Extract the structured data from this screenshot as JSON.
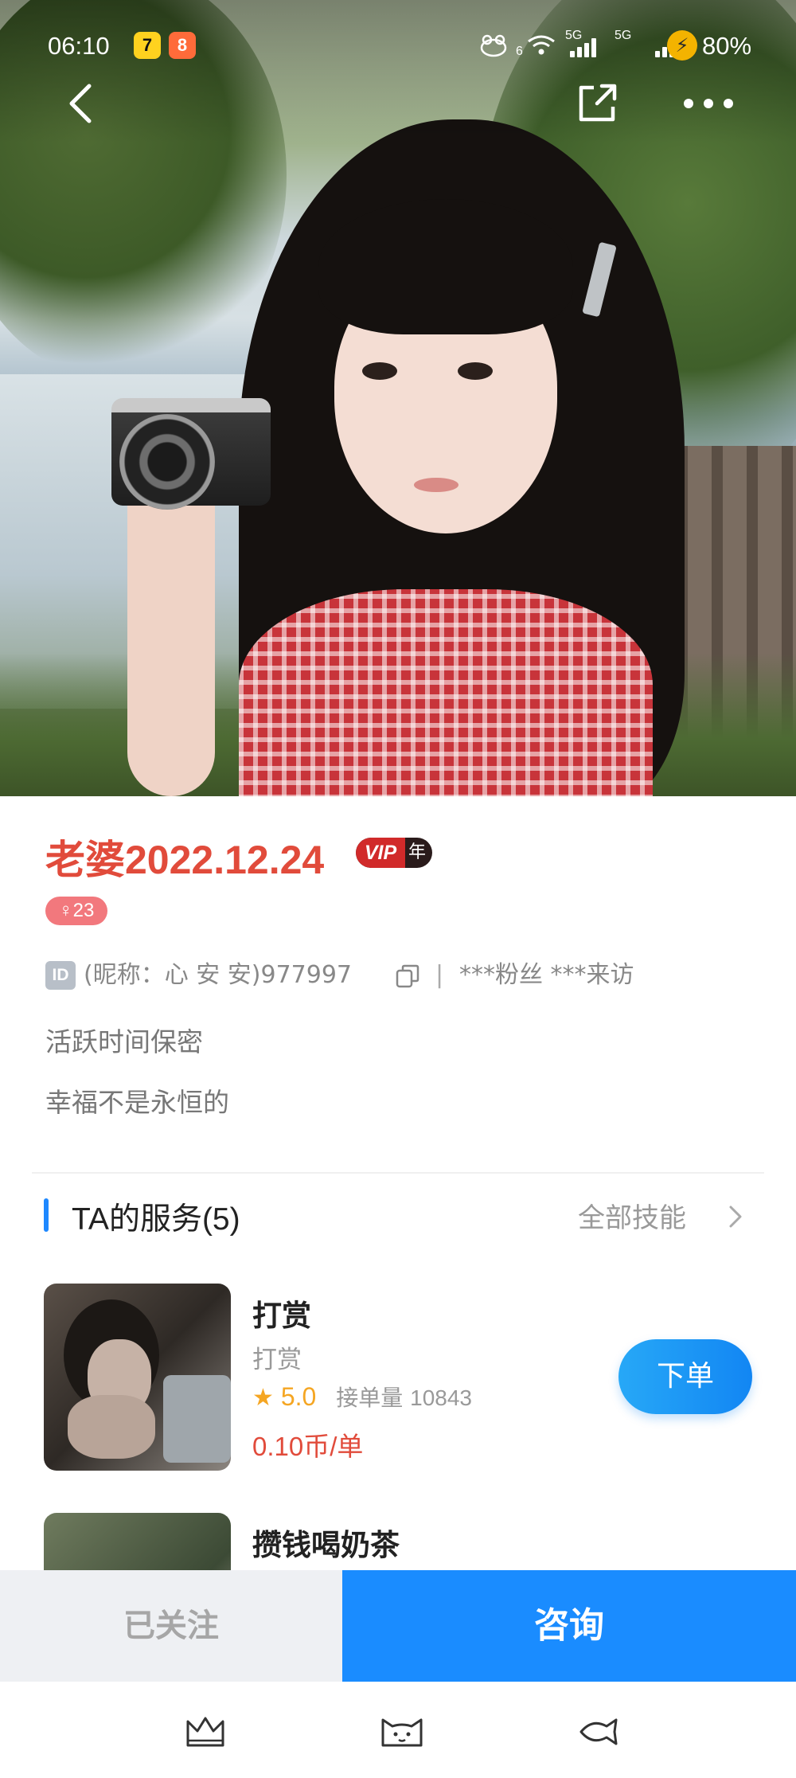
{
  "status_bar": {
    "time": "06:10",
    "app_badges": [
      "7",
      "8"
    ],
    "network_labels": [
      "6",
      "5G",
      "5G"
    ],
    "battery": "80%"
  },
  "header": {
    "icons": [
      "back-icon",
      "share-icon",
      "more-icon"
    ]
  },
  "profile": {
    "name": "老婆2022.12.24",
    "vip_label": "VIP",
    "vip_period": "年",
    "gender_age": "♀23",
    "id_tag": "ID",
    "id_text": "(昵称：心 安 安)977997",
    "separator": "|",
    "fans_visits": "***粉丝 ***来访",
    "active_time": "活跃时间保密",
    "signature": "幸福不是永恒的"
  },
  "services": {
    "title": "TA的服务(5)",
    "more_label": "全部技能",
    "items": [
      {
        "name": "打赏",
        "subtitle": "打赏",
        "rating": "5.0",
        "orders_label": "接单量",
        "orders_count": "10843",
        "price": "0.10币/单",
        "button": "下单"
      },
      {
        "name": "攒钱喝奶茶"
      }
    ]
  },
  "actions": {
    "follow": "已关注",
    "consult": "咨询"
  },
  "colors": {
    "name_red": "#e14b3b",
    "accent_blue": "#1a8cff",
    "rating_gold": "#f5a623",
    "gender_pink": "#f2787d"
  },
  "nav_icons": [
    "crown-icon",
    "cat-face-icon",
    "fish-icon"
  ]
}
